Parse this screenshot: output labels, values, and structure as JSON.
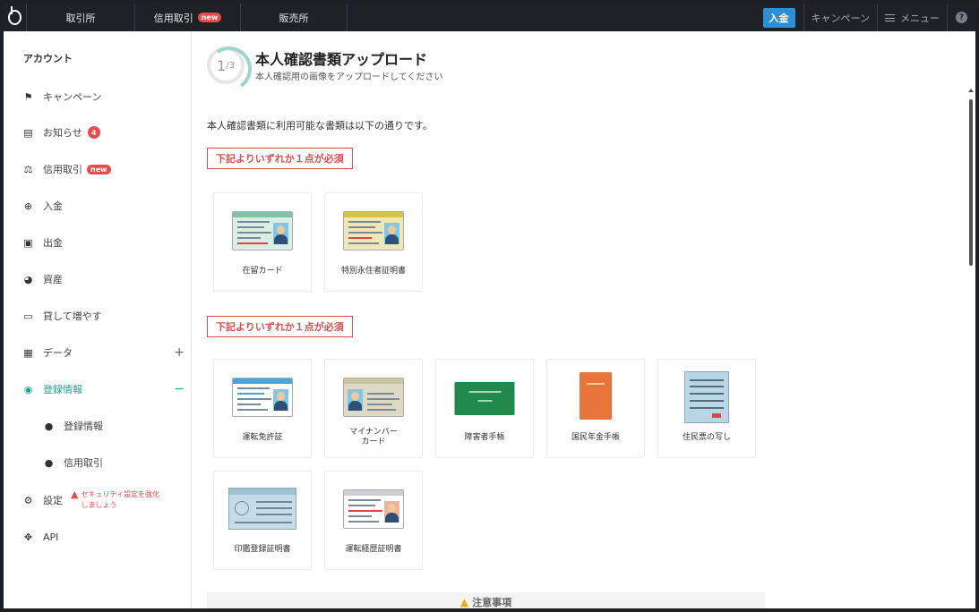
{
  "topbar": {
    "nav": [
      {
        "label": "取引所",
        "badge": ""
      },
      {
        "label": "信用取引",
        "badge": "new"
      },
      {
        "label": "販売所",
        "badge": ""
      }
    ],
    "deposit_label": "入金",
    "campaign_label": "キャンペーン",
    "menu_label": "メニュー",
    "help_glyph": "?"
  },
  "sidebar": {
    "heading": "アカウント",
    "items": [
      {
        "label": "キャンペーン",
        "icon": "flag-icon"
      },
      {
        "label": "お知らせ",
        "icon": "message-icon",
        "count": "4"
      },
      {
        "label": "信用取引",
        "icon": "scale-icon",
        "badge": "new"
      },
      {
        "label": "入金",
        "icon": "plus-circle-icon"
      },
      {
        "label": "出金",
        "icon": "wallet-icon"
      },
      {
        "label": "資産",
        "icon": "pie-chart-icon"
      },
      {
        "label": "貸して増やす",
        "icon": "cash-icon"
      },
      {
        "label": "データ",
        "icon": "clipboard-icon",
        "toggle": "+"
      },
      {
        "label": "登録情報",
        "icon": "user-circle-icon",
        "toggle": "−"
      },
      {
        "label": "登録情報",
        "icon": "user-icon"
      },
      {
        "label": "信用取引",
        "icon": "user-icon"
      },
      {
        "label": "設定",
        "icon": "gear-icon"
      },
      {
        "label": "API",
        "icon": "api-icon"
      }
    ],
    "security_warning": [
      "セキュリティ設定を強化",
      "しましょう"
    ]
  },
  "main": {
    "step_current": "1",
    "step_total": "/3",
    "title": "本人確認書類アップロード",
    "subtitle": "本人確認用の画像をアップロードしてください",
    "intro": "本人確認書類に利用可能な書類は以下の通りです。",
    "group1_label": "下記よりいずれか１点が必須",
    "group2_label": "下記よりいずれか１点が必須",
    "group1_docs": [
      "在留カード",
      "特別永住者証明書"
    ],
    "group2_docs": [
      "運転免許証",
      "マイナンバー",
      "カード",
      "障害者手帳",
      "国民年金手帳",
      "住民票の写し",
      "印鑑登録証明書",
      "運転経歴証明書"
    ],
    "notice": "注意事項"
  },
  "colors": {
    "accent": "#1aa38d",
    "danger": "#d94f4f",
    "deposit": "#2d8fd5",
    "topbar": "#1e2126"
  }
}
